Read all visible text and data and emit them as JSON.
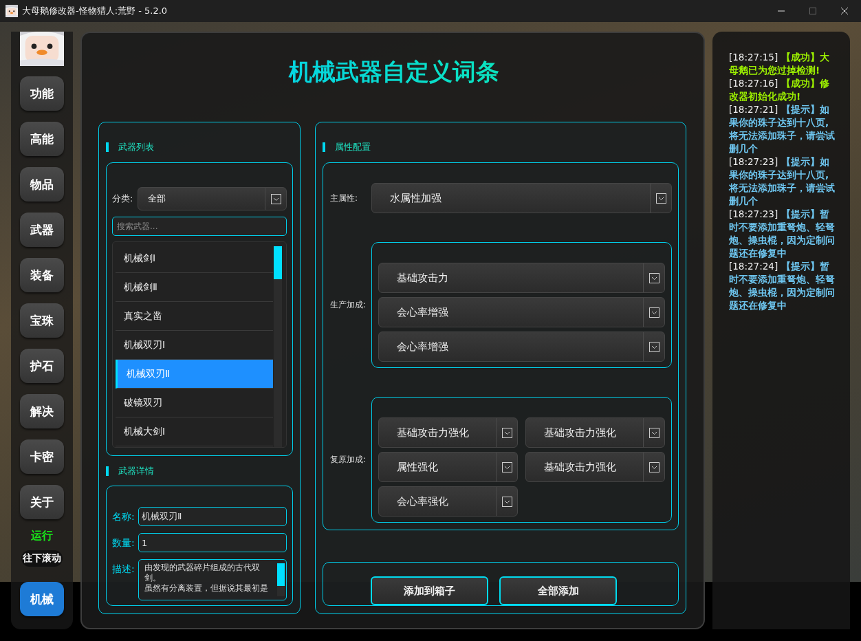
{
  "window": {
    "title": "大母鹅修改器-怪物猎人:荒野 - 5.2.0"
  },
  "sidebar": {
    "nav_items": [
      {
        "label": "功能",
        "selected": false
      },
      {
        "label": "高能",
        "selected": false
      },
      {
        "label": "物品",
        "selected": false
      },
      {
        "label": "武器",
        "selected": false
      },
      {
        "label": "装备",
        "selected": false
      },
      {
        "label": "宝珠",
        "selected": false
      },
      {
        "label": "护石",
        "selected": false
      },
      {
        "label": "解决",
        "selected": false
      },
      {
        "label": "卡密",
        "selected": false
      },
      {
        "label": "关于",
        "selected": false
      }
    ],
    "status": "运行",
    "scroll_button": "往下滚动",
    "module_button": {
      "label": "机械",
      "selected": true
    }
  },
  "page_title": "机械武器自定义词条",
  "weapon_list": {
    "heading": "武器列表",
    "category_label": "分类:",
    "category_value": "全部",
    "search_placeholder": "搜索武器...",
    "items": [
      {
        "label": "机械剑Ⅰ",
        "selected": false
      },
      {
        "label": "机械剑Ⅱ",
        "selected": false
      },
      {
        "label": "真实之凿",
        "selected": false
      },
      {
        "label": "机械双刃Ⅰ",
        "selected": false
      },
      {
        "label": "机械双刃Ⅱ",
        "selected": true
      },
      {
        "label": "破镜双刃",
        "selected": false
      },
      {
        "label": "机械大剑Ⅰ",
        "selected": false
      }
    ]
  },
  "weapon_details": {
    "heading": "武器详情",
    "name_label": "名称:",
    "name_value": "机械双刃Ⅱ",
    "quantity_label": "数量:",
    "quantity_value": "1",
    "description_label": "描述:",
    "description_lines": [
      "由发现的武器碎片组成的古代双剑。",
      "虽然有分离装置，但据说其最初是"
    ]
  },
  "attributes": {
    "heading": "属性配置",
    "main_label": "主属性:",
    "main_value": "水属性加强",
    "production_label": "生产加成:",
    "production": [
      "基础攻击力",
      "会心率增强",
      "会心率增强"
    ],
    "restoration_label": "复原加成:",
    "restoration": [
      "基础攻击力强化",
      "基础攻击力强化",
      "属性强化",
      "基础攻击力强化",
      "会心率强化"
    ]
  },
  "buttons": [
    "添加到箱子",
    "全部添加"
  ],
  "log": [
    {
      "time": "[18:27:15]",
      "kind": "success",
      "message": "【成功】大母鹅已为您过掉检测!"
    },
    {
      "time": "[18:27:16]",
      "kind": "success",
      "message": "【成功】修改器初始化成功!"
    },
    {
      "time": "[18:27:21]",
      "kind": "hint",
      "message": "【提示】如果你的珠子达到十八页,将无法添加珠子，请尝试删几个"
    },
    {
      "time": "[18:27:23]",
      "kind": "hint",
      "message": "【提示】如果你的珠子达到十八页,将无法添加珠子，请尝试删几个"
    },
    {
      "time": "[18:27:23]",
      "kind": "hint",
      "message": "【提示】暂时不要添加重弩炮、轻弩炮、操虫棍，因为定制问题还在修复中"
    },
    {
      "time": "[18:27:24]",
      "kind": "hint",
      "message": "【提示】暂时不要添加重弩炮、轻弩炮、操虫棍，因为定制问题还在修复中"
    }
  ]
}
